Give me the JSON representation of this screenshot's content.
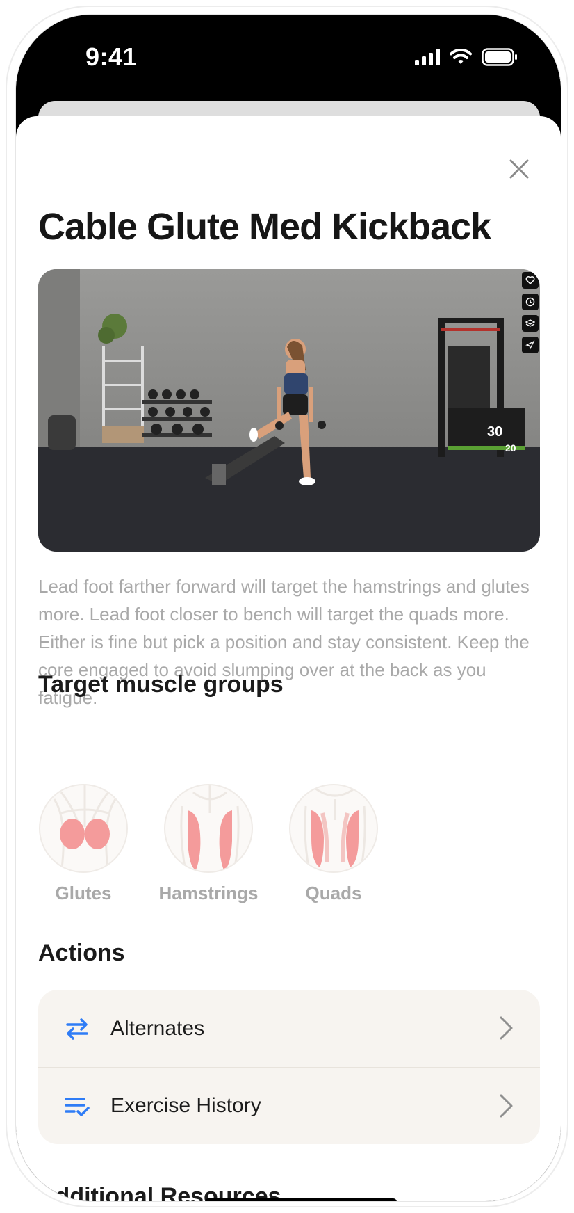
{
  "status_bar": {
    "time": "9:41"
  },
  "exercise": {
    "title": "Cable Glute Med Kickback",
    "description": "Lead foot farther forward will target the hamstrings and glutes more. Lead foot closer to bench will target the quads more. Either is fine but pick a position and stay consistent. Keep the core engaged to avoid slumping over at the back as you fatigue."
  },
  "muscles": {
    "title": "Target muscle groups",
    "items": [
      {
        "label": "Glutes",
        "icon": "glutes-diagram"
      },
      {
        "label": "Hamstrings",
        "icon": "hamstrings-diagram"
      },
      {
        "label": "Quads",
        "icon": "quads-diagram"
      }
    ]
  },
  "actions": {
    "title": "Actions",
    "items": [
      {
        "label": "Alternates",
        "icon": "swap-arrows-icon"
      },
      {
        "label": "Exercise History",
        "icon": "list-check-icon"
      }
    ]
  },
  "additional": {
    "title": "Additional Resources"
  },
  "colors": {
    "accent": "#2f7cf6",
    "muscle_highlight": "#f49b9b",
    "card_bg": "#f7f4f0",
    "muted_text": "#a9a9a9"
  }
}
